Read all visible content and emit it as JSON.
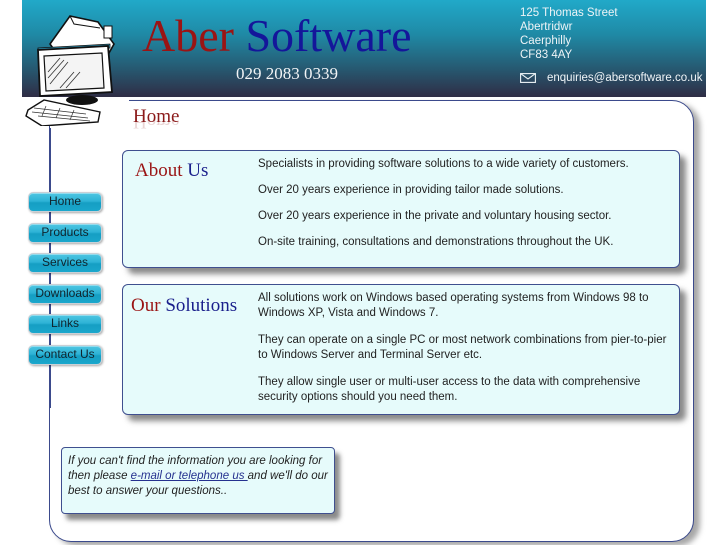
{
  "header": {
    "brand_word1": "Aber",
    "brand_word2": "Software",
    "phone": "029 2083 0339",
    "address": [
      "125 Thomas Street",
      "Abertridwr",
      "Caerphilly",
      "CF83 4AY"
    ],
    "email_icon": "envelope-icon",
    "email": "enquiries@abersoftware.co.uk",
    "logo_icon": "computer-icon"
  },
  "page": {
    "title": "Home"
  },
  "nav": {
    "items": [
      {
        "label": "Home"
      },
      {
        "label": "Products"
      },
      {
        "label": "Services"
      },
      {
        "label": "Downloads"
      },
      {
        "label": "Links"
      },
      {
        "label": "Contact Us"
      }
    ]
  },
  "about": {
    "heading_word1": "About",
    "heading_word2": "Us",
    "paragraphs": [
      "Specialists in providing software solutions to a wide variety of customers.",
      "Over 20 years experience in providing tailor made solutions.",
      "Over 20 years experience in the private and voluntary housing sector.",
      "On-site training, consultations and demonstrations throughout the UK."
    ]
  },
  "solutions": {
    "heading_word1": "Our",
    "heading_word2": "Solutions",
    "paragraphs": [
      "All solutions work on Windows based operating systems from Windows 98 to Windows XP, Vista and Windows 7.",
      "They can operate on a single PC or most network combinations from pier-to-pier to Windows Server and Terminal Server etc.",
      "They allow single user or multi-user access to the data with comprehensive security options should you need them."
    ]
  },
  "help": {
    "before_link": "If you can't find the information you are looking for then please ",
    "link_text": "e-mail or telephone us ",
    "after_link": "and we'll do our best to answer your questions.."
  },
  "colors": {
    "brand_red": "#9a1414",
    "brand_blue": "#14169a",
    "nav_button": "#2db3d6",
    "box_background": "#e6fbfb",
    "border_navy": "#3b4a8c"
  }
}
